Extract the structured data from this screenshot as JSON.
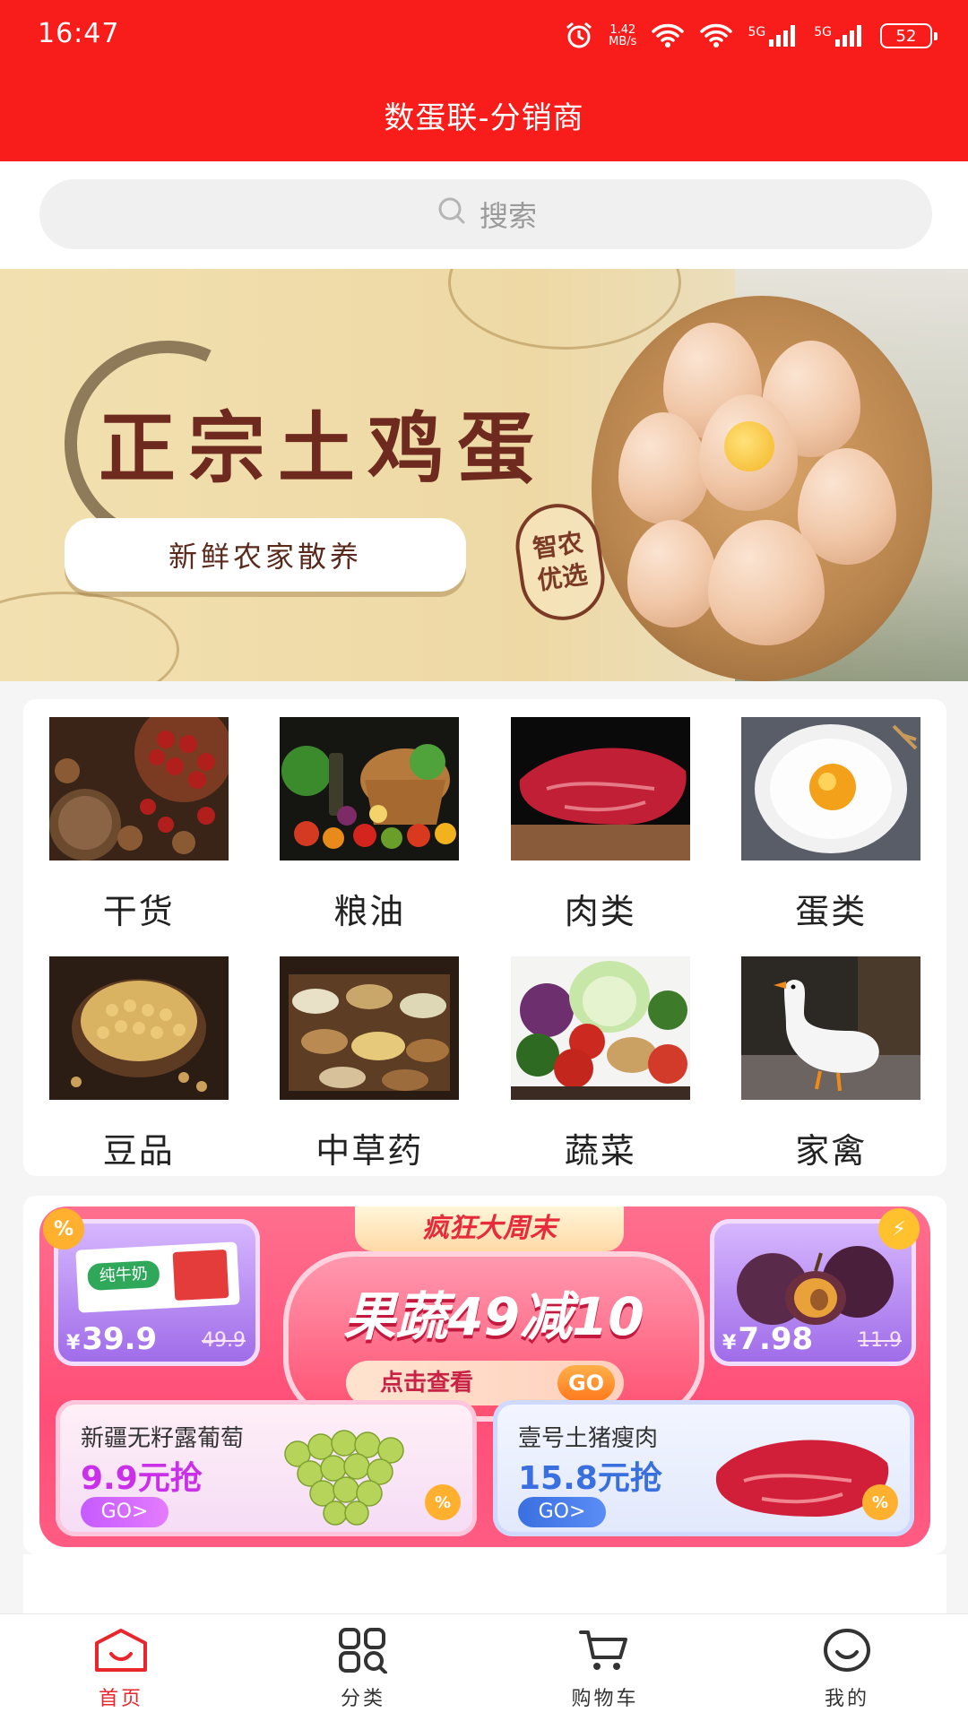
{
  "status_bar": {
    "time": "16:47",
    "net_speed_value": "1.42",
    "net_speed_unit": "MB/s",
    "signal_1": "5G",
    "signal_2": "5G",
    "battery": "52"
  },
  "header": {
    "title": "数蛋联-分销商"
  },
  "search": {
    "placeholder": "搜索"
  },
  "banner": {
    "headline": "正宗土鸡蛋",
    "tagline": "新鲜农家散养",
    "seal_line1": "智农",
    "seal_line2": "优选"
  },
  "categories": [
    {
      "label": "干货"
    },
    {
      "label": "粮油"
    },
    {
      "label": "肉类"
    },
    {
      "label": "蛋类"
    },
    {
      "label": "豆品"
    },
    {
      "label": "中草药"
    },
    {
      "label": "蔬菜"
    },
    {
      "label": "家禽"
    }
  ],
  "promo": {
    "weekend": "疯狂大周末",
    "headline": "果蔬49减10",
    "cta": "点击查看",
    "cta_go": "GO",
    "percent_badge": "%",
    "left_card": {
      "product": "纯牛奶",
      "currency": "¥",
      "price": "39.9",
      "old_price": "49.9"
    },
    "right_card": {
      "currency": "¥",
      "price": "7.98",
      "old_price": "11.9"
    },
    "deals": [
      {
        "name": "新疆无籽露葡萄",
        "price": "9.9元抢",
        "go": "GO>"
      },
      {
        "name": "壹号土猪瘦肉",
        "price": "15.8元抢",
        "go": "GO>"
      }
    ]
  },
  "bottom_nav": [
    {
      "label": "首页",
      "active": true
    },
    {
      "label": "分类",
      "active": false
    },
    {
      "label": "购物车",
      "active": false
    },
    {
      "label": "我的",
      "active": false
    }
  ],
  "colors": {
    "brand_red": "#f81c1a",
    "active_tab": "#e8262c",
    "promo_pink": "#ff4e77",
    "deal_purple": "#c930e8",
    "deal_blue": "#3a6fe0"
  }
}
